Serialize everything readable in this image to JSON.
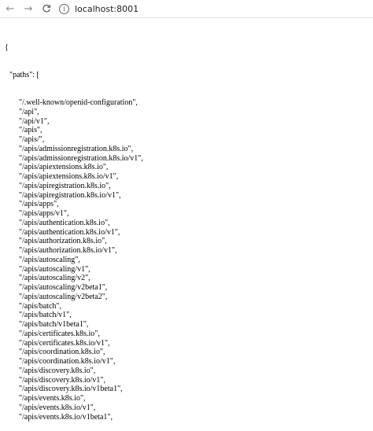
{
  "browser": {
    "back_icon": "←",
    "forward_icon": "→",
    "reload_icon": "C",
    "info_icon": "i",
    "url": "localhost:8001"
  },
  "json": {
    "open_brace": "{",
    "paths_key": "\"paths\": [",
    "paths": [
      "\"/.well-known/openid-configuration\",",
      "\"/api\",",
      "\"/api/v1\",",
      "\"/apis\",",
      "\"/apis/\",",
      "\"/apis/admissionregistration.k8s.io\",",
      "\"/apis/admissionregistration.k8s.io/v1\",",
      "\"/apis/apiextensions.k8s.io\",",
      "\"/apis/apiextensions.k8s.io/v1\",",
      "\"/apis/apiregistration.k8s.io\",",
      "\"/apis/apiregistration.k8s.io/v1\",",
      "\"/apis/apps\",",
      "\"/apis/apps/v1\",",
      "\"/apis/authentication.k8s.io\",",
      "\"/apis/authentication.k8s.io/v1\",",
      "\"/apis/authorization.k8s.io\",",
      "\"/apis/authorization.k8s.io/v1\",",
      "\"/apis/autoscaling\",",
      "\"/apis/autoscaling/v1\",",
      "\"/apis/autoscaling/v2\",",
      "\"/apis/autoscaling/v2beta1\",",
      "\"/apis/autoscaling/v2beta2\",",
      "\"/apis/batch\",",
      "\"/apis/batch/v1\",",
      "\"/apis/batch/v1beta1\",",
      "\"/apis/certificates.k8s.io\",",
      "\"/apis/certificates.k8s.io/v1\",",
      "\"/apis/coordination.k8s.io\",",
      "\"/apis/coordination.k8s.io/v1\",",
      "\"/apis/discovery.k8s.io\",",
      "\"/apis/discovery.k8s.io/v1\",",
      "\"/apis/discovery.k8s.io/v1beta1\",",
      "\"/apis/events.k8s.io\",",
      "\"/apis/events.k8s.io/v1\",",
      "\"/apis/events.k8s.io/v1beta1\","
    ]
  }
}
